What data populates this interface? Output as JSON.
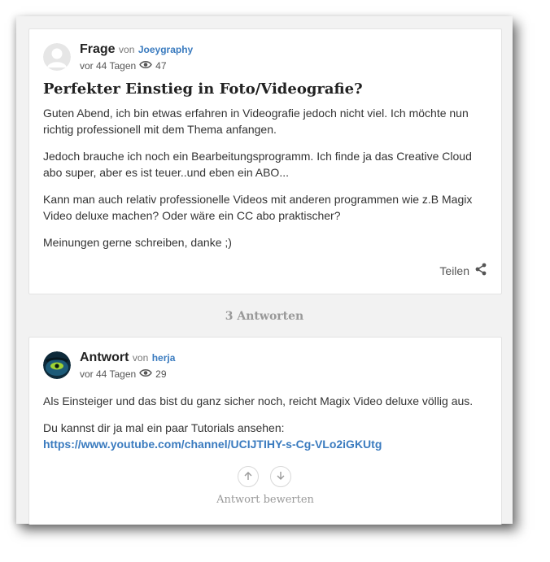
{
  "question": {
    "kind": "Frage",
    "by": "von",
    "user": "Joeygraphy",
    "age": "vor 44 Tagen",
    "views": "47",
    "title": "Perfekter Einstieg in Foto/Videografie?",
    "paragraphs": [
      "Guten Abend, ich bin etwas erfahren in Videografie jedoch nicht viel. Ich möchte nun richtig professionell mit dem Thema anfangen.",
      "Jedoch brauche ich noch ein Bearbeitungsprogramm. Ich finde ja das Creative Cloud abo super, aber es ist teuer..und eben ein ABO...",
      "Kann man auch relativ professionelle Videos mit anderen programmen wie z.B Magix Video deluxe machen? Oder wäre ein CC abo praktischer?",
      "Meinungen gerne schreiben, danke ;)"
    ],
    "share_label": "Teilen"
  },
  "answers_count": "3 Antworten",
  "answer": {
    "kind": "Antwort",
    "by": "von",
    "user": "herja",
    "age": "vor 44 Tagen",
    "views": "29",
    "paragraph1": "Als Einsteiger und das bist du ganz sicher noch, reicht Magix Video deluxe völlig aus.",
    "paragraph2": "Du kannst dir ja mal ein paar Tutorials ansehen:",
    "link": "https://www.youtube.com/channel/UCIJTIHY-s-Cg-VLo2iGKUtg",
    "rate_label": "Antwort bewerten"
  },
  "colors": {
    "link": "#3a7bbf",
    "muted": "#999999"
  },
  "icons": [
    "eye-icon",
    "share-icon",
    "upvote-arrow-icon",
    "downvote-arrow-icon"
  ]
}
